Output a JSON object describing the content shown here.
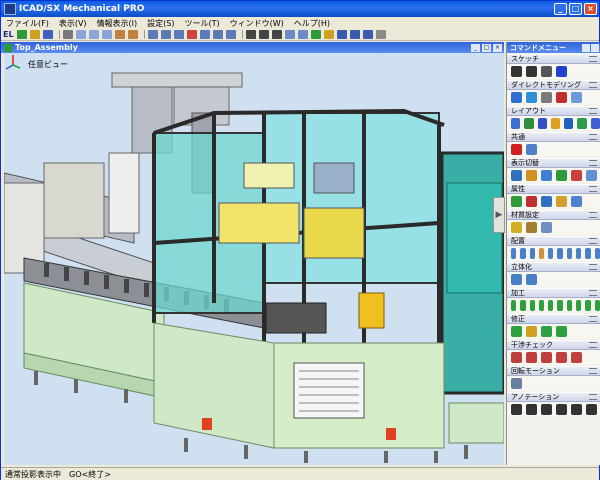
{
  "window": {
    "title": "ICAD/SX Mechanical PRO"
  },
  "menubar": {
    "items": [
      "ファイル(F)",
      "表示(V)",
      "情報表示(I)",
      "設定(S)",
      "ツール(T)",
      "ウィンドウ(W)",
      "ヘルプ(H)"
    ]
  },
  "toolbar": {
    "el_label": "EL"
  },
  "document": {
    "tab_name": "Top_Assembly"
  },
  "viewport": {
    "view_name": "任意ビュー"
  },
  "command_menu": {
    "title": "コマンドメニュー",
    "sections": [
      {
        "label": "スケッチ",
        "colors": [
          "#333333",
          "#333333",
          "#555555",
          "#2244cc"
        ]
      },
      {
        "label": "ダイレクトモデリング",
        "colors": [
          "#2f6fd0",
          "#2f8fd8",
          "#7a7a7a",
          "#c03030",
          "#6a9bd8"
        ]
      },
      {
        "label": "レイアウト",
        "colors": [
          "#3d6fd0",
          "#2f8f40",
          "#3050c8",
          "#e0a020",
          "#2060c0",
          "#2f9a50",
          "#4060d0"
        ]
      },
      {
        "label": "共通",
        "colors": [
          "#d02020",
          "#5080c8"
        ]
      },
      {
        "label": "表示切替",
        "colors": [
          "#3070c0",
          "#d09020",
          "#4080d0",
          "#2f9a3a",
          "#c84040",
          "#6090d0"
        ]
      },
      {
        "label": "属性",
        "colors": [
          "#2f9a3a",
          "#c03030",
          "#3070c0",
          "#d0a030",
          "#5080d0"
        ]
      },
      {
        "label": "材質設定",
        "colors": [
          "#d0b020",
          "#a08030",
          "#7090c0"
        ]
      },
      {
        "label": "配置",
        "colors": [
          "#4a80c8",
          "#4a80c8",
          "#4a80c8",
          "#d09040",
          "#4a80c8",
          "#4a80c8",
          "#4a80c8",
          "#4a80c8",
          "#4a80c8",
          "#4a80c8"
        ]
      },
      {
        "label": "立体化",
        "colors": [
          "#4a80c8",
          "#4a80c8"
        ]
      },
      {
        "label": "加工",
        "colors": [
          "#2fa040",
          "#2fa040",
          "#2fa040",
          "#2fa040",
          "#2fa040",
          "#2fa040",
          "#2fa040",
          "#2fa040",
          "#2fa040",
          "#2fa040"
        ]
      },
      {
        "label": "修正",
        "colors": [
          "#2fa040",
          "#d0a020",
          "#2fa040",
          "#2fa040"
        ]
      },
      {
        "label": "干渉チェック",
        "colors": [
          "#c04040",
          "#c04040",
          "#c04040",
          "#c04040",
          "#c04040"
        ]
      },
      {
        "label": "回転モーション",
        "colors": [
          "#6a7fa0"
        ]
      },
      {
        "label": "アノテーション",
        "colors": [
          "#333333",
          "#333333",
          "#333333",
          "#333333",
          "#333333",
          "#333333"
        ]
      }
    ]
  },
  "statusbar": {
    "left": "通常投影表示中",
    "right": "GO<終了>"
  }
}
